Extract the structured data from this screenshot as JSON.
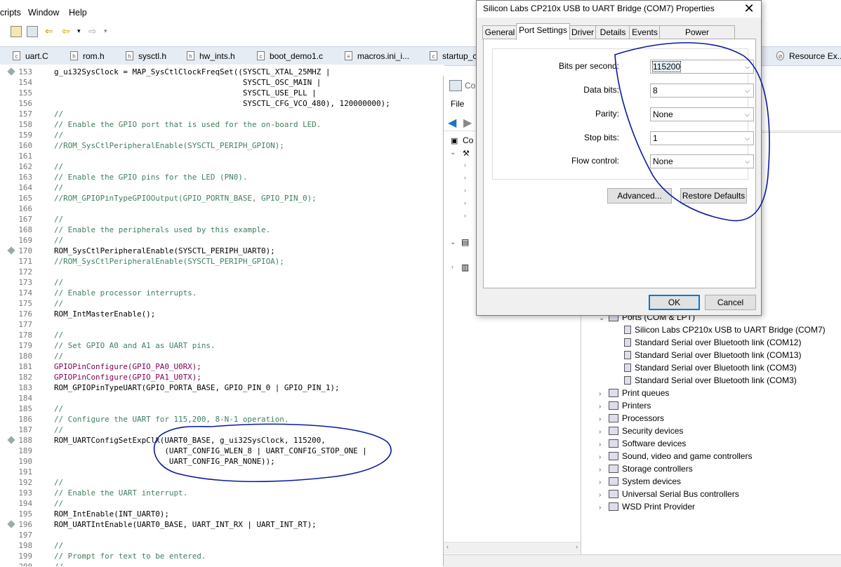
{
  "menubar": {
    "items": [
      {
        "label": "cripts",
        "u": ""
      },
      {
        "label": "Window",
        "u": "W"
      },
      {
        "label": "Help",
        "u": "H"
      }
    ]
  },
  "editor_tabs": [
    "uart.C",
    "rom.h",
    "sysctl.h",
    "hw_ints.h",
    "boot_demo1.c",
    "macros.ini_i...",
    "startup_c",
    "Resource Ex..."
  ],
  "code_lines": [
    {
      "n": "153",
      "t": "g_ui32SysClock = MAP_SysCtlClockFreqSet((SYSCTL_XTAL_25MHZ |",
      "k": "code",
      "m": true
    },
    {
      "n": "154",
      "t": "                                         SYSCTL_OSC_MAIN |",
      "k": "code"
    },
    {
      "n": "155",
      "t": "                                         SYSCTL_USE_PLL |",
      "k": "code"
    },
    {
      "n": "156",
      "t": "                                         SYSCTL_CFG_VCO_480), 120000000);",
      "k": "code"
    },
    {
      "n": "157",
      "t": "//",
      "k": "cmt"
    },
    {
      "n": "158",
      "t": "// Enable the GPIO port that is used for the on-board LED.",
      "k": "cmt"
    },
    {
      "n": "159",
      "t": "//",
      "k": "cmt"
    },
    {
      "n": "160",
      "t": "//ROM_SysCtlPeripheralEnable(SYSCTL_PERIPH_GPION);",
      "k": "cmt"
    },
    {
      "n": "161",
      "t": "",
      "k": "code"
    },
    {
      "n": "162",
      "t": "//",
      "k": "cmt"
    },
    {
      "n": "163",
      "t": "// Enable the GPIO pins for the LED (PN0).",
      "k": "cmt"
    },
    {
      "n": "164",
      "t": "//",
      "k": "cmt"
    },
    {
      "n": "165",
      "t": "//ROM_GPIOPinTypeGPIOOutput(GPIO_PORTN_BASE, GPIO_PIN_0);",
      "k": "cmt"
    },
    {
      "n": "166",
      "t": "",
      "k": "code"
    },
    {
      "n": "167",
      "t": "//",
      "k": "cmt"
    },
    {
      "n": "168",
      "t": "// Enable the peripherals used by this example.",
      "k": "cmt"
    },
    {
      "n": "169",
      "t": "//",
      "k": "cmt"
    },
    {
      "n": "170",
      "t": "ROM_SysCtlPeripheralEnable(SYSCTL_PERIPH_UART0);",
      "k": "code",
      "m": true
    },
    {
      "n": "171",
      "t": "//ROM_SysCtlPeripheralEnable(SYSCTL_PERIPH_GPIOA);",
      "k": "cmt"
    },
    {
      "n": "172",
      "t": "",
      "k": "code"
    },
    {
      "n": "173",
      "t": "//",
      "k": "cmt"
    },
    {
      "n": "174",
      "t": "// Enable processor interrupts.",
      "k": "cmt"
    },
    {
      "n": "175",
      "t": "//",
      "k": "cmt"
    },
    {
      "n": "176",
      "t": "ROM_IntMasterEnable();",
      "k": "code"
    },
    {
      "n": "177",
      "t": "",
      "k": "code"
    },
    {
      "n": "178",
      "t": "//",
      "k": "cmt"
    },
    {
      "n": "179",
      "t": "// Set GPIO A0 and A1 as UART pins.",
      "k": "cmt"
    },
    {
      "n": "180",
      "t": "//",
      "k": "cmt"
    },
    {
      "n": "181",
      "t": "GPIOPinConfigure(GPIO_PA0_U0RX);",
      "k": "fnp"
    },
    {
      "n": "182",
      "t": "GPIOPinConfigure(GPIO_PA1_U0TX);",
      "k": "fnp"
    },
    {
      "n": "183",
      "t": "ROM_GPIOPinTypeUART(GPIO_PORTA_BASE, GPIO_PIN_0 | GPIO_PIN_1);",
      "k": "code"
    },
    {
      "n": "184",
      "t": "",
      "k": "code"
    },
    {
      "n": "185",
      "t": "//",
      "k": "cmt"
    },
    {
      "n": "186",
      "t": "// Configure the UART for 115,200, 8-N-1 operation.",
      "k": "cmt"
    },
    {
      "n": "187",
      "t": "//",
      "k": "cmt"
    },
    {
      "n": "188",
      "t": "ROM_UARTConfigSetExpClk(UART0_BASE, g_ui32SysClock, 115200,",
      "k": "code",
      "m": true
    },
    {
      "n": "189",
      "t": "                        (UART_CONFIG_WLEN_8 | UART_CONFIG_STOP_ONE |",
      "k": "code"
    },
    {
      "n": "190",
      "t": "                         UART_CONFIG_PAR_NONE));",
      "k": "code"
    },
    {
      "n": "191",
      "t": "",
      "k": "code"
    },
    {
      "n": "192",
      "t": "//",
      "k": "cmt"
    },
    {
      "n": "193",
      "t": "// Enable the UART interrupt.",
      "k": "cmt"
    },
    {
      "n": "194",
      "t": "//",
      "k": "cmt"
    },
    {
      "n": "195",
      "t": "ROM_IntEnable(INT_UART0);",
      "k": "code"
    },
    {
      "n": "196",
      "t": "ROM_UARTIntEnable(UART0_BASE, UART_INT_RX | UART_INT_RT);",
      "k": "code",
      "m": true
    },
    {
      "n": "197",
      "t": "",
      "k": "code"
    },
    {
      "n": "198",
      "t": "//",
      "k": "cmt"
    },
    {
      "n": "199",
      "t": "// Prompt for text to be entered.",
      "k": "cmt"
    },
    {
      "n": "200",
      "t": "//",
      "k": "cmt"
    }
  ],
  "device_manager": {
    "title_fragment": "Co",
    "menu_file": "File",
    "tree_fragment": "Co",
    "ports_label": "Ports (COM & LPT)",
    "ports": [
      "Silicon Labs CP210x USB to UART Bridge (COM7)",
      "Standard Serial over Bluetooth link (COM12)",
      "Standard Serial over Bluetooth link (COM13)",
      "Standard Serial over Bluetooth link (COM3)",
      "Standard Serial over Bluetooth link (COM3)"
    ],
    "categories": [
      "Print queues",
      "Printers",
      "Processors",
      "Security devices",
      "Software devices",
      "Sound, video and game controllers",
      "Storage controllers",
      "System devices",
      "Universal Serial Bus controllers",
      "WSD Print Provider"
    ]
  },
  "dialog": {
    "title": "Silicon Labs CP210x USB to UART Bridge (COM7) Properties",
    "tabs": [
      "General",
      "Port Settings",
      "Driver",
      "Details",
      "Events",
      "Power Management"
    ],
    "active_tab": "Port Settings",
    "fields": [
      {
        "label": "Bits per second:",
        "value": "115200"
      },
      {
        "label": "Data bits:",
        "value": "8"
      },
      {
        "label": "Parity:",
        "value": "None"
      },
      {
        "label": "Stop bits:",
        "value": "1"
      },
      {
        "label": "Flow control:",
        "value": "None"
      }
    ],
    "advanced_label": "Advanced...",
    "restore_label": "Restore Defaults",
    "ok_label": "OK",
    "cancel_label": "Cancel"
  },
  "colors": {
    "comment": "#3f7f5f",
    "keyword_fn": "#7f0055",
    "annotation_ink": "#0a1a9c",
    "tab_bar": "#e6ecf3"
  }
}
